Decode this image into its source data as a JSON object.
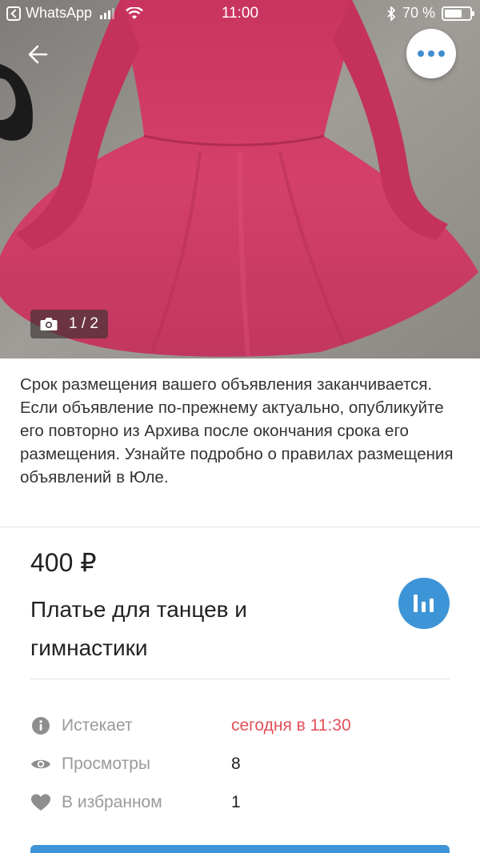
{
  "status_bar": {
    "back_app": "WhatsApp",
    "time": "11:00",
    "battery": "70 %"
  },
  "gallery": {
    "counter": "1 / 2",
    "current": 1,
    "total": 2,
    "dress_color": "#d4406a"
  },
  "notice": {
    "text": "Срок размещения вашего объявления заканчивается. Если объявление по-прежнему актуально, опубликуйте его повторно из Архива после окончания срока его размещения. Узнайте подробно о правилах размещения объявлений в Юле."
  },
  "listing": {
    "price": "400 ₽",
    "title": "Платье для танцев и гимнастики"
  },
  "details": [
    {
      "icon": "info-icon",
      "label": "Истекает",
      "value": "сегодня в 11:30",
      "highlight": true
    },
    {
      "icon": "eye-icon",
      "label": "Просмотры",
      "value": "8",
      "highlight": false
    },
    {
      "icon": "heart-icon",
      "label": "В избранном",
      "value": "1",
      "highlight": false
    }
  ],
  "colors": {
    "accent": "#3d94d6",
    "expire_red": "#e3505a",
    "label_gray": "#9a9a9a"
  }
}
